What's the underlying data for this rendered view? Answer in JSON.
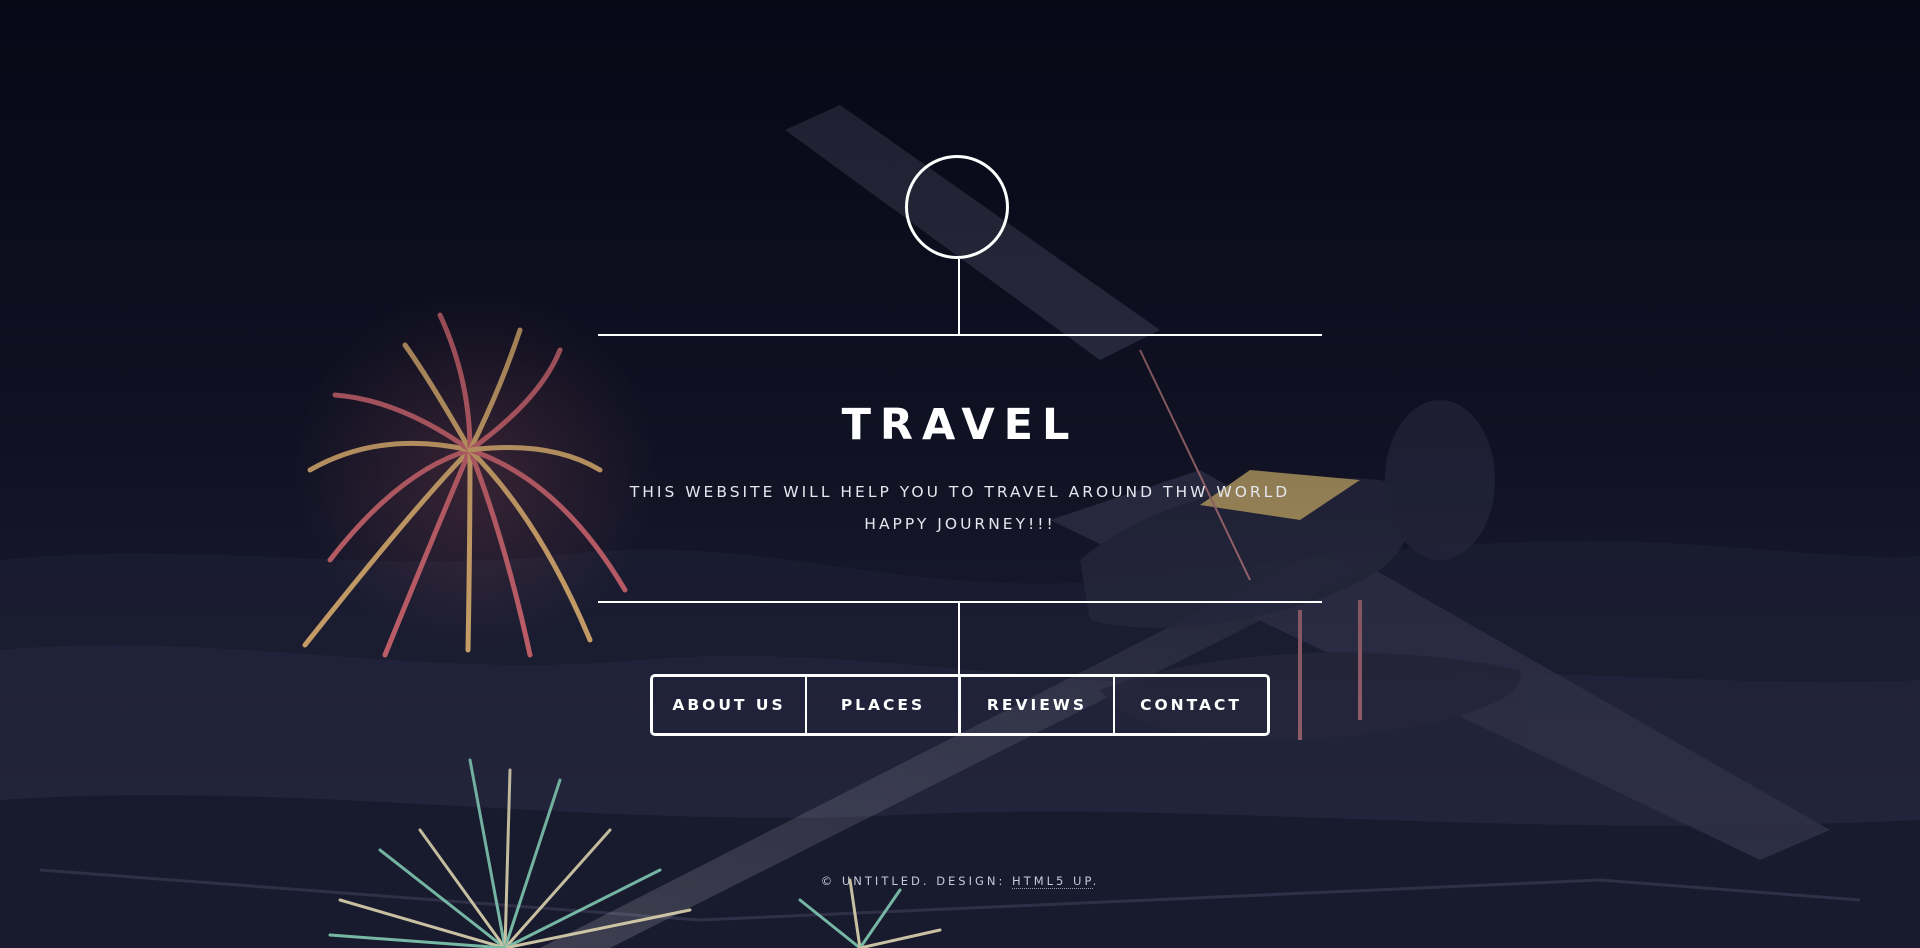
{
  "hero": {
    "title": "TRAVEL",
    "subtitle_line1": "THIS WEBSITE WILL HELP YOU TO TRAVEL AROUND THW WORLD",
    "subtitle_line2": "HAPPY JOURNEY!!!"
  },
  "nav": {
    "items": [
      {
        "label": "ABOUT US"
      },
      {
        "label": "PLACES"
      },
      {
        "label": "REVIEWS"
      },
      {
        "label": "CONTACT"
      }
    ]
  },
  "footer": {
    "prefix": "© UNTITLED. DESIGN: ",
    "link_label": "HTML5 UP",
    "suffix": "."
  },
  "colors": {
    "background": "#0d0f1d",
    "text": "#ffffff",
    "firework_warm": "#f6c27a",
    "firework_pink": "#e8727a",
    "firework_teal": "#8fe0c4"
  }
}
